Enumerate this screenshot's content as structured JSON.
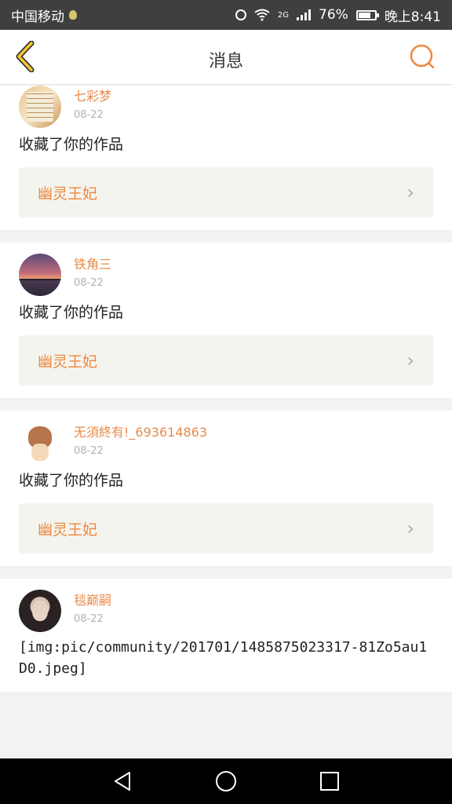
{
  "status_bar": {
    "carrier": "中国移动",
    "network": "2G",
    "battery": "76%",
    "battery_level": 0.76,
    "time": "晚上8:41"
  },
  "header": {
    "title": "消息",
    "back_icon": "chevron-left-icon",
    "search_icon": "search-icon"
  },
  "messages": [
    {
      "username": "七彩梦",
      "date": "08-22",
      "action": "收藏了你的作品",
      "work_title": "幽灵王妃"
    },
    {
      "username": "铁角三",
      "date": "08-22",
      "action": "收藏了你的作品",
      "work_title": "幽灵王妃"
    },
    {
      "username": "无須終有!_693614863",
      "date": "08-22",
      "action": "收藏了你的作品",
      "work_title": "幽灵王妃"
    },
    {
      "username": "毯巅嗣",
      "date": "08-22",
      "content": "[img:pic/community/201701/1485875023317-81Zo5au1D0.jpeg]"
    }
  ],
  "nav": {
    "back": "triangle-back-icon",
    "home": "circle-home-icon",
    "recents": "square-recents-icon"
  },
  "colors": {
    "accent": "#f0883e",
    "username": "#e88a4a",
    "header_bg": "#ffffff",
    "statusbar_bg": "#3f3f3f"
  }
}
